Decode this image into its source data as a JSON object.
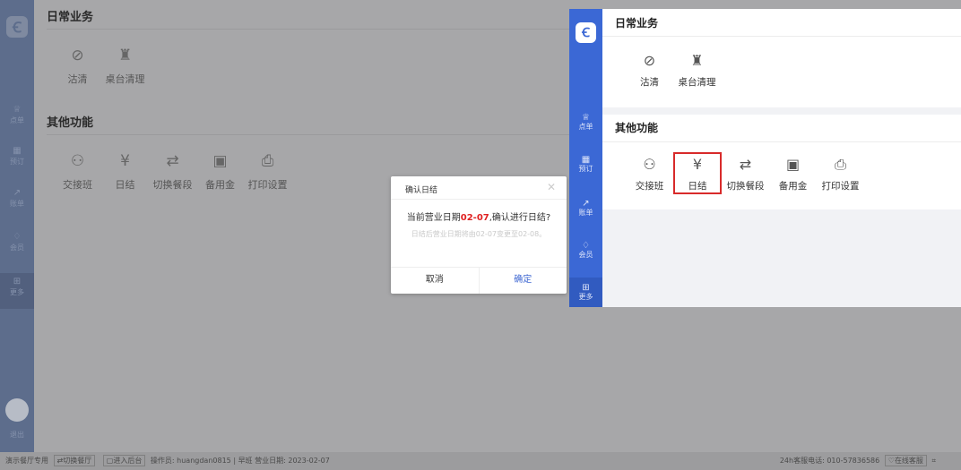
{
  "sidebar": {
    "items": [
      {
        "icon": "crown-icon",
        "label": "点单",
        "glyph": "♕"
      },
      {
        "icon": "table-icon",
        "label": "预订",
        "glyph": "▦"
      },
      {
        "icon": "chart-icon",
        "label": "账单",
        "glyph": "↗"
      },
      {
        "icon": "diamond-icon",
        "label": "会员",
        "glyph": "♢"
      },
      {
        "icon": "grid-icon",
        "label": "更多",
        "glyph": "⊞"
      }
    ],
    "exit_label": "退出"
  },
  "sections": {
    "daily": {
      "title": "日常业务",
      "items": [
        {
          "label": "沽清",
          "glyph": "⊘"
        },
        {
          "label": "桌台清理",
          "glyph": "♜"
        }
      ]
    },
    "other": {
      "title": "其他功能",
      "items": [
        {
          "label": "交接班",
          "glyph": "⚇"
        },
        {
          "label": "日结",
          "glyph": "¥"
        },
        {
          "label": "切换餐段",
          "glyph": "⇄"
        },
        {
          "label": "备用金",
          "glyph": "▣"
        },
        {
          "label": "打印设置",
          "glyph": "⎙"
        }
      ]
    }
  },
  "modal": {
    "title": "确认日结",
    "question_prefix": "当前营业日期",
    "question_date": "02-07",
    "question_suffix": ",确认进行日结?",
    "note": "日结后营业日期将由02-07变更至02-08。",
    "cancel_label": "取消",
    "confirm_label": "确定"
  },
  "status": {
    "store": "演示餐厅专用",
    "switch_store": "切换餐厅",
    "enter_backend": "进入后台",
    "operator_label": "操作员:",
    "operator": "huangdan0815",
    "shift": "早班",
    "business_date_label": "营业日期:",
    "business_date": "2023-02-07",
    "hotline_label": "24h客服电话:",
    "hotline": "010-57836586",
    "online_service": "在线客服"
  },
  "colors": {
    "brand_blue": "#3b68d5",
    "highlight_red": "#d82a2a",
    "date_red": "#e02020"
  }
}
